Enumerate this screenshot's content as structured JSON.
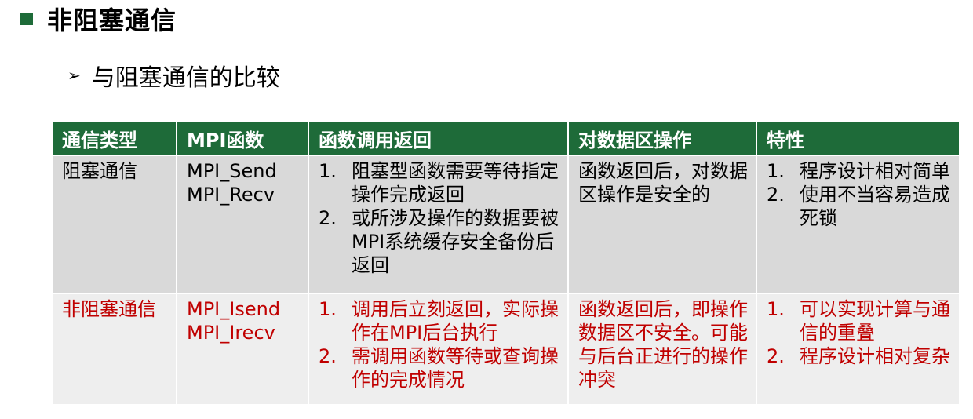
{
  "title": "非阻塞通信",
  "subtitle": "与阻塞通信的比较",
  "table": {
    "headers": [
      "通信类型",
      "MPI函数",
      "函数调用返回",
      "对数据区操作",
      "特性"
    ],
    "rows": [
      {
        "type": "阻塞通信",
        "functions": [
          "MPI_Send",
          "MPI_Recv"
        ],
        "return_items": [
          {
            "num": "1.",
            "text": "阻塞型函数需要等待指定操作完成返回"
          },
          {
            "num": "2.",
            "text": "或所涉及操作的数据要被MPI系统缓存安全备份后返回"
          }
        ],
        "data_op": "函数返回后，对数据区操作是安全的",
        "features": [
          {
            "num": "1.",
            "text": "程序设计相对简单"
          },
          {
            "num": "2.",
            "text": "使用不当容易造成死锁"
          }
        ]
      },
      {
        "type": "非阻塞通信",
        "functions": [
          "MPI_Isend",
          "MPI_Irecv"
        ],
        "return_items": [
          {
            "num": "1.",
            "text": "调用后立刻返回，实际操作在MPI后台执行"
          },
          {
            "num": "2.",
            "text": "需调用函数等待或查询操作的完成情况"
          }
        ],
        "data_op": "函数返回后，即操作数据区不安全。可能与后台正进行的操作冲突",
        "features": [
          {
            "num": "1.",
            "text": "可以实现计算与通信的重叠"
          },
          {
            "num": "2.",
            "text": "程序设计相对复杂"
          }
        ]
      }
    ]
  },
  "colors": {
    "accent": "#1e6b39",
    "row_blocking_bg": "#d9d9d9",
    "row_nonblocking_bg": "#eeeeee",
    "nonblocking_text": "#c00000"
  }
}
